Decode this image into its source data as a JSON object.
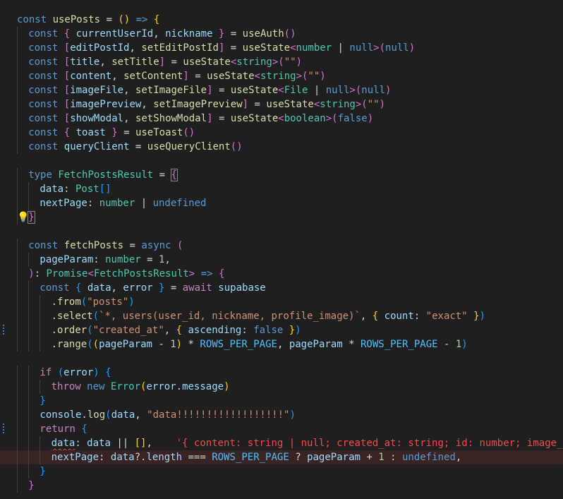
{
  "editor": {
    "language": "typescript",
    "theme_colors": {
      "background": "#1f1f1f",
      "keyword": "#569cd6",
      "control": "#c586c0",
      "variable": "#9cdcfe",
      "function": "#dcdcaa",
      "type": "#4ec9b0",
      "string": "#ce9178",
      "number": "#b5cea8",
      "error": "#f14c4c",
      "bracket_gold": "#ffd700",
      "bracket_orchid": "#da70d6",
      "bracket_blue": "#179fff"
    },
    "gutter_markers": [
      {
        "line": 14,
        "kind": "lightbulb-icon"
      },
      {
        "line": 22,
        "kind": "modified-bar"
      },
      {
        "line": 29,
        "kind": "modified-bar"
      },
      {
        "line": 31,
        "kind": "error-line"
      }
    ],
    "lines": [
      {
        "indent": 0,
        "tokens": [
          [
            "k",
            "const "
          ],
          [
            "f",
            "usePosts"
          ],
          [
            "p",
            " = "
          ],
          [
            "b1",
            "()"
          ],
          [
            "p",
            " "
          ],
          [
            "k",
            "=>"
          ],
          [
            "p",
            " "
          ],
          [
            "b1",
            "{"
          ]
        ]
      },
      {
        "indent": 1,
        "tokens": [
          [
            "k",
            "const "
          ],
          [
            "b2",
            "{ "
          ],
          [
            "v",
            "currentUserId"
          ],
          [
            "p",
            ", "
          ],
          [
            "v",
            "nickname"
          ],
          [
            "b2",
            " }"
          ],
          [
            "p",
            " = "
          ],
          [
            "f",
            "useAuth"
          ],
          [
            "b2",
            "()"
          ]
        ]
      },
      {
        "indent": 1,
        "tokens": [
          [
            "k",
            "const "
          ],
          [
            "b2",
            "["
          ],
          [
            "v",
            "editPostId"
          ],
          [
            "p",
            ", "
          ],
          [
            "f",
            "setEditPostId"
          ],
          [
            "b2",
            "]"
          ],
          [
            "p",
            " = "
          ],
          [
            "f",
            "useState"
          ],
          [
            "b2",
            "<"
          ],
          [
            "ty",
            "number"
          ],
          [
            "p",
            " | "
          ],
          [
            "k",
            "null"
          ],
          [
            "b2",
            ">"
          ],
          [
            "b2",
            "("
          ],
          [
            "k",
            "null"
          ],
          [
            "b2",
            ")"
          ]
        ]
      },
      {
        "indent": 1,
        "tokens": [
          [
            "k",
            "const "
          ],
          [
            "b2",
            "["
          ],
          [
            "v",
            "title"
          ],
          [
            "p",
            ", "
          ],
          [
            "f",
            "setTitle"
          ],
          [
            "b2",
            "]"
          ],
          [
            "p",
            " = "
          ],
          [
            "f",
            "useState"
          ],
          [
            "b2",
            "<"
          ],
          [
            "ty",
            "string"
          ],
          [
            "b2",
            ">"
          ],
          [
            "b2",
            "("
          ],
          [
            "s",
            "\"\""
          ],
          [
            "b2",
            ")"
          ]
        ]
      },
      {
        "indent": 1,
        "tokens": [
          [
            "k",
            "const "
          ],
          [
            "b2",
            "["
          ],
          [
            "v",
            "content"
          ],
          [
            "p",
            ", "
          ],
          [
            "f",
            "setContent"
          ],
          [
            "b2",
            "]"
          ],
          [
            "p",
            " = "
          ],
          [
            "f",
            "useState"
          ],
          [
            "b2",
            "<"
          ],
          [
            "ty",
            "string"
          ],
          [
            "b2",
            ">"
          ],
          [
            "b2",
            "("
          ],
          [
            "s",
            "\"\""
          ],
          [
            "b2",
            ")"
          ]
        ]
      },
      {
        "indent": 1,
        "tokens": [
          [
            "k",
            "const "
          ],
          [
            "b2",
            "["
          ],
          [
            "v",
            "imageFile"
          ],
          [
            "p",
            ", "
          ],
          [
            "f",
            "setImageFile"
          ],
          [
            "b2",
            "]"
          ],
          [
            "p",
            " = "
          ],
          [
            "f",
            "useState"
          ],
          [
            "b2",
            "<"
          ],
          [
            "ty",
            "File"
          ],
          [
            "p",
            " | "
          ],
          [
            "k",
            "null"
          ],
          [
            "b2",
            ">"
          ],
          [
            "b2",
            "("
          ],
          [
            "k",
            "null"
          ],
          [
            "b2",
            ")"
          ]
        ]
      },
      {
        "indent": 1,
        "tokens": [
          [
            "k",
            "const "
          ],
          [
            "b2",
            "["
          ],
          [
            "v",
            "imagePreview"
          ],
          [
            "p",
            ", "
          ],
          [
            "f",
            "setImagePreview"
          ],
          [
            "b2",
            "]"
          ],
          [
            "p",
            " = "
          ],
          [
            "f",
            "useState"
          ],
          [
            "b2",
            "<"
          ],
          [
            "ty",
            "string"
          ],
          [
            "b2",
            ">"
          ],
          [
            "b2",
            "("
          ],
          [
            "s",
            "\"\""
          ],
          [
            "b2",
            ")"
          ]
        ]
      },
      {
        "indent": 1,
        "tokens": [
          [
            "k",
            "const "
          ],
          [
            "b2",
            "["
          ],
          [
            "v",
            "showModal"
          ],
          [
            "p",
            ", "
          ],
          [
            "f",
            "setShowModal"
          ],
          [
            "b2",
            "]"
          ],
          [
            "p",
            " = "
          ],
          [
            "f",
            "useState"
          ],
          [
            "b2",
            "<"
          ],
          [
            "ty",
            "boolean"
          ],
          [
            "b2",
            ">"
          ],
          [
            "b2",
            "("
          ],
          [
            "k",
            "false"
          ],
          [
            "b2",
            ")"
          ]
        ]
      },
      {
        "indent": 1,
        "tokens": [
          [
            "k",
            "const "
          ],
          [
            "b2",
            "{ "
          ],
          [
            "v",
            "toast"
          ],
          [
            "b2",
            " }"
          ],
          [
            "p",
            " = "
          ],
          [
            "f",
            "useToast"
          ],
          [
            "b2",
            "()"
          ]
        ]
      },
      {
        "indent": 1,
        "tokens": [
          [
            "k",
            "const "
          ],
          [
            "v",
            "queryClient"
          ],
          [
            "p",
            " = "
          ],
          [
            "f",
            "useQueryClient"
          ],
          [
            "b2",
            "()"
          ]
        ]
      },
      {
        "indent": 0,
        "tokens": []
      },
      {
        "indent": 1,
        "tokens": [
          [
            "k",
            "type "
          ],
          [
            "ty",
            "FetchPostsResult"
          ],
          [
            "p",
            " = "
          ],
          [
            "bm",
            "{"
          ]
        ]
      },
      {
        "indent": 2,
        "tokens": [
          [
            "v",
            "data"
          ],
          [
            "p",
            ": "
          ],
          [
            "ty",
            "Post"
          ],
          [
            "b3",
            "[]"
          ]
        ]
      },
      {
        "indent": 2,
        "tokens": [
          [
            "v",
            "nextPage"
          ],
          [
            "p",
            ": "
          ],
          [
            "ty",
            "number"
          ],
          [
            "p",
            " | "
          ],
          [
            "k",
            "undefined"
          ]
        ]
      },
      {
        "indent": 1,
        "tokens": [
          [
            "bm",
            "}"
          ]
        ]
      },
      {
        "indent": 0,
        "tokens": []
      },
      {
        "indent": 1,
        "tokens": [
          [
            "k",
            "const "
          ],
          [
            "f",
            "fetchPosts"
          ],
          [
            "p",
            " = "
          ],
          [
            "k",
            "async "
          ],
          [
            "b2",
            "("
          ]
        ]
      },
      {
        "indent": 2,
        "tokens": [
          [
            "v",
            "pageParam"
          ],
          [
            "p",
            ": "
          ],
          [
            "ty",
            "number"
          ],
          [
            "p",
            " = "
          ],
          [
            "n",
            "1"
          ],
          [
            "p",
            ","
          ]
        ]
      },
      {
        "indent": 1,
        "tokens": [
          [
            "b2",
            ")"
          ],
          [
            "p",
            ": "
          ],
          [
            "ty",
            "Promise"
          ],
          [
            "b2",
            "<"
          ],
          [
            "ty",
            "FetchPostsResult"
          ],
          [
            "b2",
            ">"
          ],
          [
            "p",
            " "
          ],
          [
            "k",
            "=>"
          ],
          [
            "p",
            " "
          ],
          [
            "b2",
            "{"
          ]
        ]
      },
      {
        "indent": 2,
        "tokens": [
          [
            "k",
            "const "
          ],
          [
            "b3",
            "{ "
          ],
          [
            "v",
            "data"
          ],
          [
            "p",
            ", "
          ],
          [
            "v",
            "error"
          ],
          [
            "b3",
            " }"
          ],
          [
            "p",
            " = "
          ],
          [
            "c",
            "await "
          ],
          [
            "v",
            "supabase"
          ]
        ]
      },
      {
        "indent": 3,
        "tokens": [
          [
            "p",
            "."
          ],
          [
            "f",
            "from"
          ],
          [
            "b3",
            "("
          ],
          [
            "s",
            "\"posts\""
          ],
          [
            "b3",
            ")"
          ]
        ]
      },
      {
        "indent": 3,
        "tokens": [
          [
            "p",
            "."
          ],
          [
            "f",
            "select"
          ],
          [
            "b3",
            "("
          ],
          [
            "s",
            "`*, users(user_id, nickname, profile_image)`"
          ],
          [
            "p",
            ", "
          ],
          [
            "b1",
            "{ "
          ],
          [
            "v",
            "count"
          ],
          [
            "p",
            ": "
          ],
          [
            "s",
            "\"exact\""
          ],
          [
            "b1",
            " }"
          ],
          [
            "b3",
            ")"
          ]
        ]
      },
      {
        "indent": 3,
        "tokens": [
          [
            "p",
            "."
          ],
          [
            "f",
            "order"
          ],
          [
            "b3",
            "("
          ],
          [
            "s",
            "\"created_at\""
          ],
          [
            "p",
            ", "
          ],
          [
            "b1",
            "{ "
          ],
          [
            "v",
            "ascending"
          ],
          [
            "p",
            ": "
          ],
          [
            "k",
            "false"
          ],
          [
            "b1",
            " }"
          ],
          [
            "b3",
            ")"
          ]
        ]
      },
      {
        "indent": 3,
        "tokens": [
          [
            "p",
            "."
          ],
          [
            "f",
            "range"
          ],
          [
            "b3",
            "("
          ],
          [
            "b1",
            "("
          ],
          [
            "v",
            "pageParam"
          ],
          [
            "p",
            " - "
          ],
          [
            "n",
            "1"
          ],
          [
            "b1",
            ")"
          ],
          [
            "p",
            " * "
          ],
          [
            "kc",
            "ROWS_PER_PAGE"
          ],
          [
            "p",
            ", "
          ],
          [
            "v",
            "pageParam"
          ],
          [
            "p",
            " * "
          ],
          [
            "kc",
            "ROWS_PER_PAGE"
          ],
          [
            "p",
            " - "
          ],
          [
            "n",
            "1"
          ],
          [
            "b3",
            ")"
          ]
        ]
      },
      {
        "indent": 0,
        "tokens": []
      },
      {
        "indent": 2,
        "tokens": [
          [
            "c",
            "if "
          ],
          [
            "b3",
            "("
          ],
          [
            "v",
            "error"
          ],
          [
            "b3",
            ")"
          ],
          [
            "p",
            " "
          ],
          [
            "b3",
            "{"
          ]
        ]
      },
      {
        "indent": 3,
        "tokens": [
          [
            "c",
            "throw "
          ],
          [
            "k",
            "new "
          ],
          [
            "ty",
            "Error"
          ],
          [
            "b1",
            "("
          ],
          [
            "v",
            "error"
          ],
          [
            "p",
            "."
          ],
          [
            "v",
            "message"
          ],
          [
            "b1",
            ")"
          ]
        ]
      },
      {
        "indent": 2,
        "tokens": [
          [
            "b3",
            "}"
          ]
        ]
      },
      {
        "indent": 2,
        "tokens": [
          [
            "v",
            "console"
          ],
          [
            "p",
            "."
          ],
          [
            "f",
            "log"
          ],
          [
            "b3",
            "("
          ],
          [
            "v",
            "data"
          ],
          [
            "p",
            ", "
          ],
          [
            "s",
            "\"data!!!!!!!!!!!!!!!!!!\""
          ],
          [
            "b3",
            ")"
          ]
        ]
      },
      {
        "indent": 2,
        "tokens": [
          [
            "c",
            "return "
          ],
          [
            "b3",
            "{"
          ]
        ]
      },
      {
        "indent": 3,
        "tokens": [
          [
            "sq",
            "data"
          ],
          [
            "p",
            ": "
          ],
          [
            "v",
            "data"
          ],
          [
            "p",
            " || "
          ],
          [
            "b1",
            "[]"
          ],
          [
            "p",
            ",    "
          ],
          [
            "e",
            "'{ content: string | null; created_at: string; id: number; image_url: string | null; title: string; user_id: string; }[]'"
          ]
        ]
      },
      {
        "indent": 3,
        "tokens": [
          [
            "v",
            "nextPage"
          ],
          [
            "p",
            ": "
          ],
          [
            "v",
            "data"
          ],
          [
            "p",
            "?."
          ],
          [
            "v",
            "length"
          ],
          [
            "p",
            " === "
          ],
          [
            "kc",
            "ROWS_PER_PAGE"
          ],
          [
            "p",
            " ? "
          ],
          [
            "v",
            "pageParam"
          ],
          [
            "p",
            " + "
          ],
          [
            "n",
            "1"
          ],
          [
            "p",
            " : "
          ],
          [
            "k",
            "undefined"
          ],
          [
            "p",
            ","
          ]
        ]
      },
      {
        "indent": 2,
        "tokens": [
          [
            "b3",
            "}"
          ]
        ]
      },
      {
        "indent": 1,
        "tokens": [
          [
            "b2",
            "}"
          ]
        ]
      }
    ]
  }
}
